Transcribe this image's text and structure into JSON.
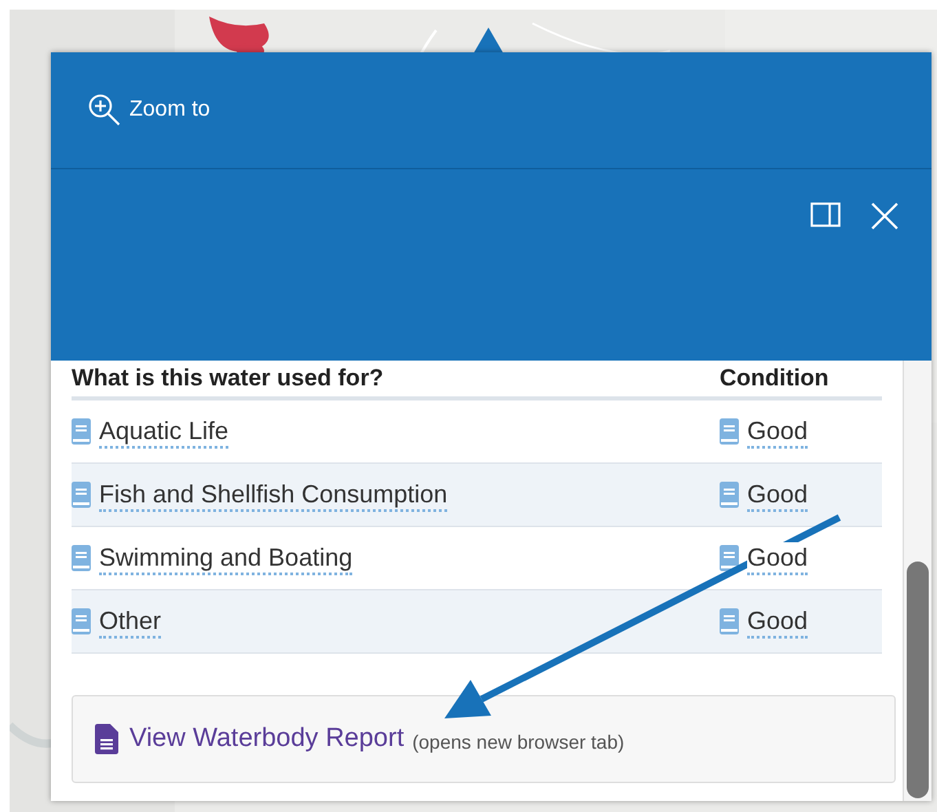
{
  "popup": {
    "zoom_label": "Zoom to"
  },
  "table": {
    "columns": [
      "What is this water used for?",
      "Condition"
    ],
    "rows": [
      {
        "use": "Aquatic Life",
        "condition": "Good"
      },
      {
        "use": "Fish and Shellfish Consumption",
        "condition": "Good"
      },
      {
        "use": "Swimming and Boating",
        "condition": "Good"
      },
      {
        "use": "Other",
        "condition": "Good"
      }
    ]
  },
  "report": {
    "link": "View Waterbody Report",
    "note": "(opens new browser tab)"
  }
}
